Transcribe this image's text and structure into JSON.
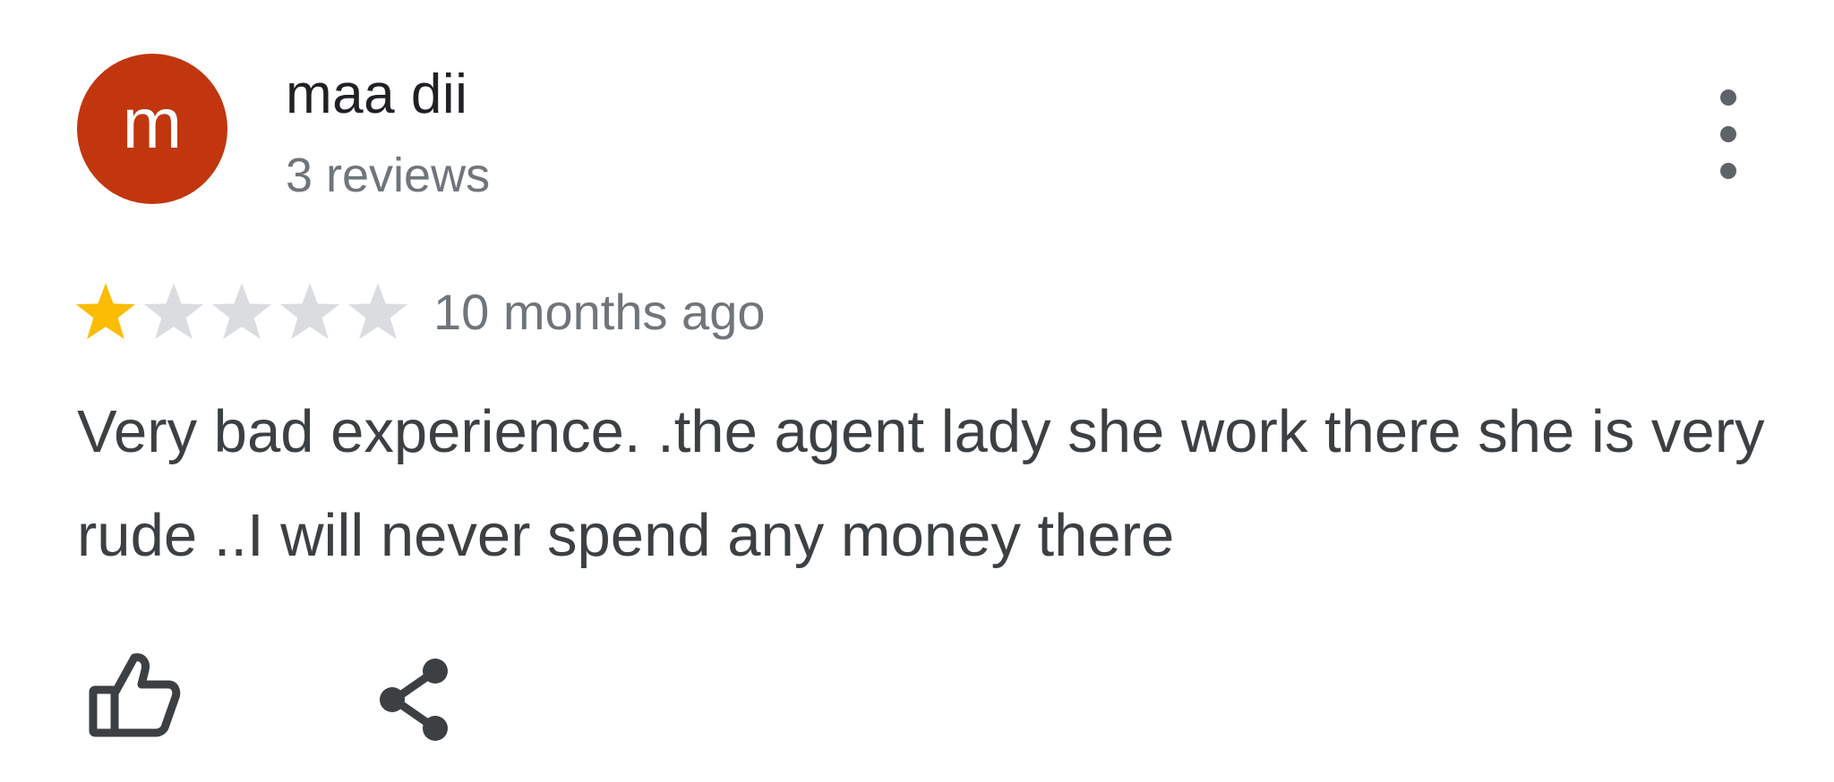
{
  "review": {
    "author": {
      "name": "maa dii",
      "initial": "m",
      "avatar_color": "#c1360f",
      "reviews_count": "3 reviews"
    },
    "rating": {
      "value": 1,
      "max": 5,
      "filled_color": "#fbbc04",
      "empty_color": "#dadce0"
    },
    "time_ago": "10 months ago",
    "text": "Very bad experience. .the agent lady she work there she is very rude ..I will never spend any money there"
  },
  "icons": {
    "more": "more-vert-icon",
    "like": "thumbs-up-icon",
    "share": "share-icon",
    "star": "star-icon"
  }
}
